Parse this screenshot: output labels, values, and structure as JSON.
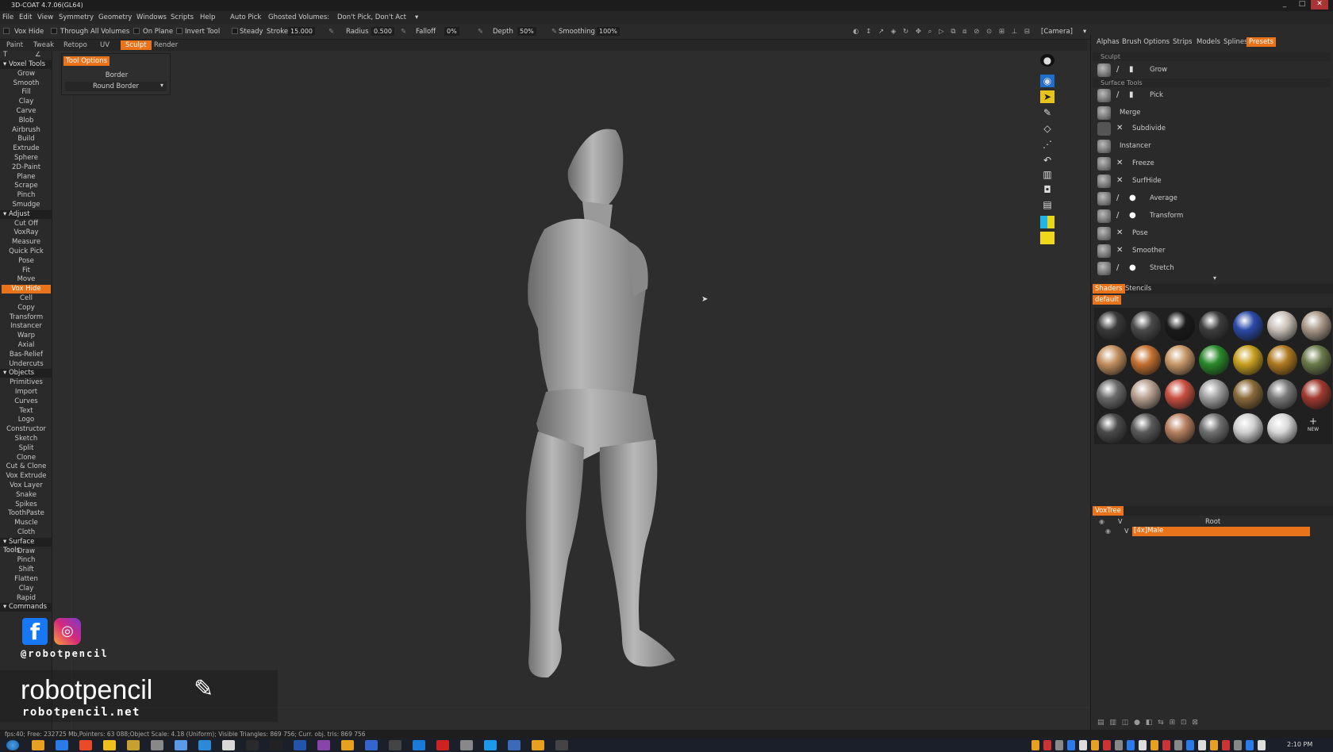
{
  "window": {
    "title": "3D-COAT 4.7.06(GL64)",
    "controls": [
      "_",
      "□",
      "✕"
    ]
  },
  "menu": [
    "File",
    "Edit",
    "View",
    "Symmetry",
    "Geometry",
    "Windows",
    "Scripts",
    "Help",
    "Auto Pick",
    "Ghosted Volumes:",
    "Don't Pick, Don't Act"
  ],
  "toolbar": {
    "vox_hide": "Vox Hide",
    "through_all": "Through All Volumes",
    "on_plane": "On Plane",
    "invert_tool": "Invert Tool",
    "steady": "Steady",
    "stroke_label": "Stroke:",
    "stroke_value": "15.000",
    "radius_label": "Radius",
    "radius_value": "0.500",
    "falloff_label": "Falloff",
    "falloff_value": "0%",
    "depth_label": "Depth",
    "depth_value": "50%",
    "smoothing_label": "Smoothing",
    "smoothing_value": "100%",
    "camera": "[Camera]"
  },
  "rooms": [
    "Paint",
    "Tweak",
    "Retopo",
    "UV",
    "Sculpt",
    "Render"
  ],
  "active_room": "Sculpt",
  "left_tools": {
    "voxel_header": "Voxel Tools",
    "voxel": [
      "Grow",
      "Smooth",
      "Fill",
      "Clay",
      "Carve",
      "Blob",
      "Airbrush",
      "Build",
      "Extrude",
      "Sphere",
      "2D-Paint",
      "Plane",
      "Scrape",
      "Pinch",
      "Smudge"
    ],
    "adjust_header": "Adjust",
    "adjust": [
      "Cut Off",
      "VoxRay",
      "Measure",
      "Quick Pick",
      "Pose",
      "Fit",
      "Move",
      "Vox Hide",
      "Cell",
      "Copy",
      "Transform",
      "Instancer",
      "Warp",
      "Axial",
      "Bas-Relief",
      "Undercuts"
    ],
    "objects_header": "Objects",
    "objects": [
      "Primitives",
      "Import",
      "Curves",
      "Text",
      "Logo",
      "Constructor",
      "Sketch",
      "Split",
      "Clone",
      "Cut & Clone",
      "Vox Extrude",
      "Vox Layer",
      "Snake",
      "Spikes",
      "ToothPaste",
      "Muscle",
      "Cloth"
    ],
    "surface_header": "Surface Tools",
    "surface": [
      "Draw",
      "Pinch",
      "Shift",
      "Flatten",
      "Clay",
      "Rapid"
    ],
    "commands_header": "Commands",
    "active_tool": "Vox Hide"
  },
  "tool_options": {
    "title": "Tool Options",
    "border_label": "Border",
    "border_value": "Round Border"
  },
  "right_tabs": [
    "Alphas",
    "Brush Options",
    "Strips",
    "Models",
    "Splines",
    "Presets"
  ],
  "active_right_tab": "Presets",
  "presets": {
    "sculpt_header": "Sculpt",
    "surface_header": "Surface Tools",
    "items": [
      "Grow",
      "Pick",
      "Merge",
      "Subdivide",
      "Instancer",
      "Freeze",
      "SurfHide",
      "Average",
      "Transform",
      "Pose",
      "Smoother",
      "Stretch"
    ]
  },
  "shaders": {
    "tabs": [
      "Shaders",
      "Stencils"
    ],
    "default_label": "default",
    "new_label": "NEW",
    "colors": [
      "#3a3a3a",
      "#4a4a4a",
      "#1a1a1a",
      "#3d3d3d",
      "#2a4aa8",
      "#c9c0b8",
      "#a89888",
      "#c49060",
      "#c47030",
      "#c89868",
      "#2a8a2a",
      "#c8a020",
      "#b07a20",
      "#6a7a4a",
      "#6a6a6a",
      "#b8a090",
      "#c85040",
      "#a0a0a0",
      "#8a6a3a",
      "#7a7a7a",
      "#a03a30",
      "#4a4a4a",
      "#5a5a5a",
      "#b88060",
      "#707070",
      "#d0d0d0",
      "#d8d8d8"
    ]
  },
  "voxtree": {
    "title": "VoxTree",
    "root": "Root",
    "item": "[4x]Male"
  },
  "status": "fps:40;   Free: 232725 Mb,Pointers: 63 088;Object Scale: 4.18 (Uniform); Visible Triangles: 869 756; Curr. obj. tris: 869 756",
  "clock": "2:10 PM",
  "watermark": {
    "handle": "@robotpencil",
    "brand": "robotpencil",
    "site": "robotpencil.net"
  }
}
